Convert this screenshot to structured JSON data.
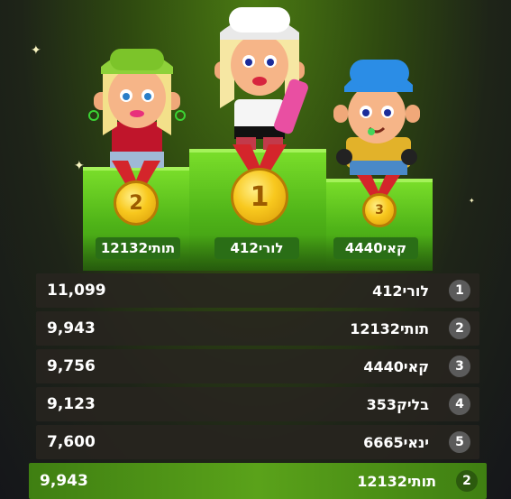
{
  "podium": [
    {
      "place": "1",
      "name": "לורי412"
    },
    {
      "place": "2",
      "name": "תותי12132"
    },
    {
      "place": "3",
      "name": "קאי4440"
    }
  ],
  "leaderboard": [
    {
      "rank": "1",
      "name": "לורי412",
      "score": "11,099"
    },
    {
      "rank": "2",
      "name": "תותי12132",
      "score": "9,943"
    },
    {
      "rank": "3",
      "name": "קאי4440",
      "score": "9,756"
    },
    {
      "rank": "4",
      "name": "בליק353",
      "score": "9,123"
    },
    {
      "rank": "5",
      "name": "ינאי6665",
      "score": "7,600"
    }
  ],
  "current_user": {
    "rank": "2",
    "name": "תותי12132",
    "score": "9,943"
  },
  "icons": [
    "gold-medal-icon",
    "sparkle-icon",
    "avatar-image"
  ],
  "colors": {
    "podium_green": "#5cc21c",
    "highlight_row": "#4e9616",
    "medal_gold": "#f8c81e"
  }
}
